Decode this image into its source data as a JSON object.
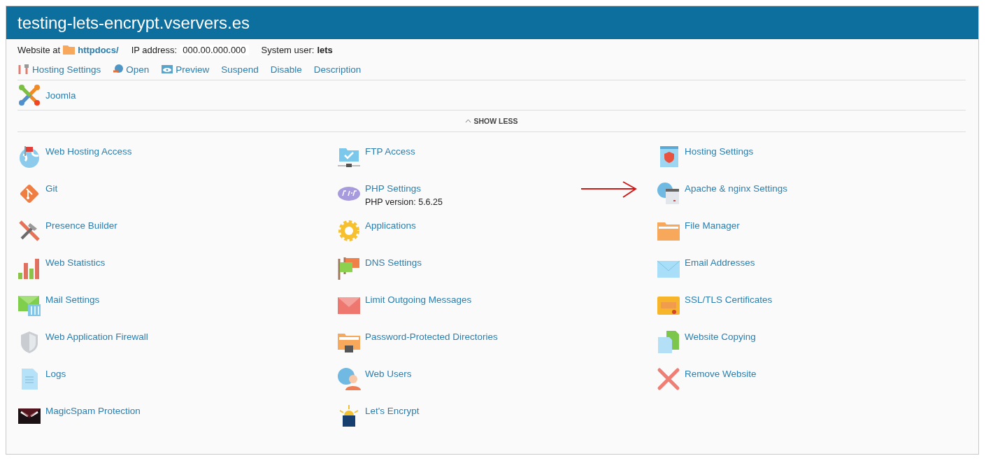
{
  "title": "testing-lets-encrypt.vservers.es",
  "info": {
    "website_label": "Website at",
    "path": "httpdocs/",
    "ip_label": "IP address:",
    "ip": "000.00.000.000",
    "user_label": "System user:",
    "user": "lets"
  },
  "actions": [
    "Hosting Settings",
    "Open",
    "Preview",
    "Suspend",
    "Disable",
    "Description"
  ],
  "apps": [
    "Joomla"
  ],
  "toggle": "SHOW LESS",
  "columns": [
    [
      {
        "label": "Web Hosting Access"
      },
      {
        "label": "Git"
      },
      {
        "label": "Presence Builder"
      },
      {
        "label": "Web Statistics"
      },
      {
        "label": "Mail Settings"
      },
      {
        "label": "Web Application Firewall"
      },
      {
        "label": "Logs"
      },
      {
        "label": "MagicSpam Protection"
      }
    ],
    [
      {
        "label": "FTP Access"
      },
      {
        "label": "PHP Settings",
        "note": "PHP version: 5.6.25"
      },
      {
        "label": "Applications"
      },
      {
        "label": "DNS Settings"
      },
      {
        "label": "Limit Outgoing Messages"
      },
      {
        "label": "Password-Protected Directories"
      },
      {
        "label": "Web Users"
      },
      {
        "label": "Let's Encrypt"
      }
    ],
    [
      {
        "label": "Hosting Settings"
      },
      {
        "label": "Apache & nginx Settings",
        "annotated": true
      },
      {
        "label": "File Manager"
      },
      {
        "label": "Email Addresses"
      },
      {
        "label": "SSL/TLS Certificates"
      },
      {
        "label": "Website Copying"
      },
      {
        "label": "Remove Website"
      }
    ]
  ]
}
